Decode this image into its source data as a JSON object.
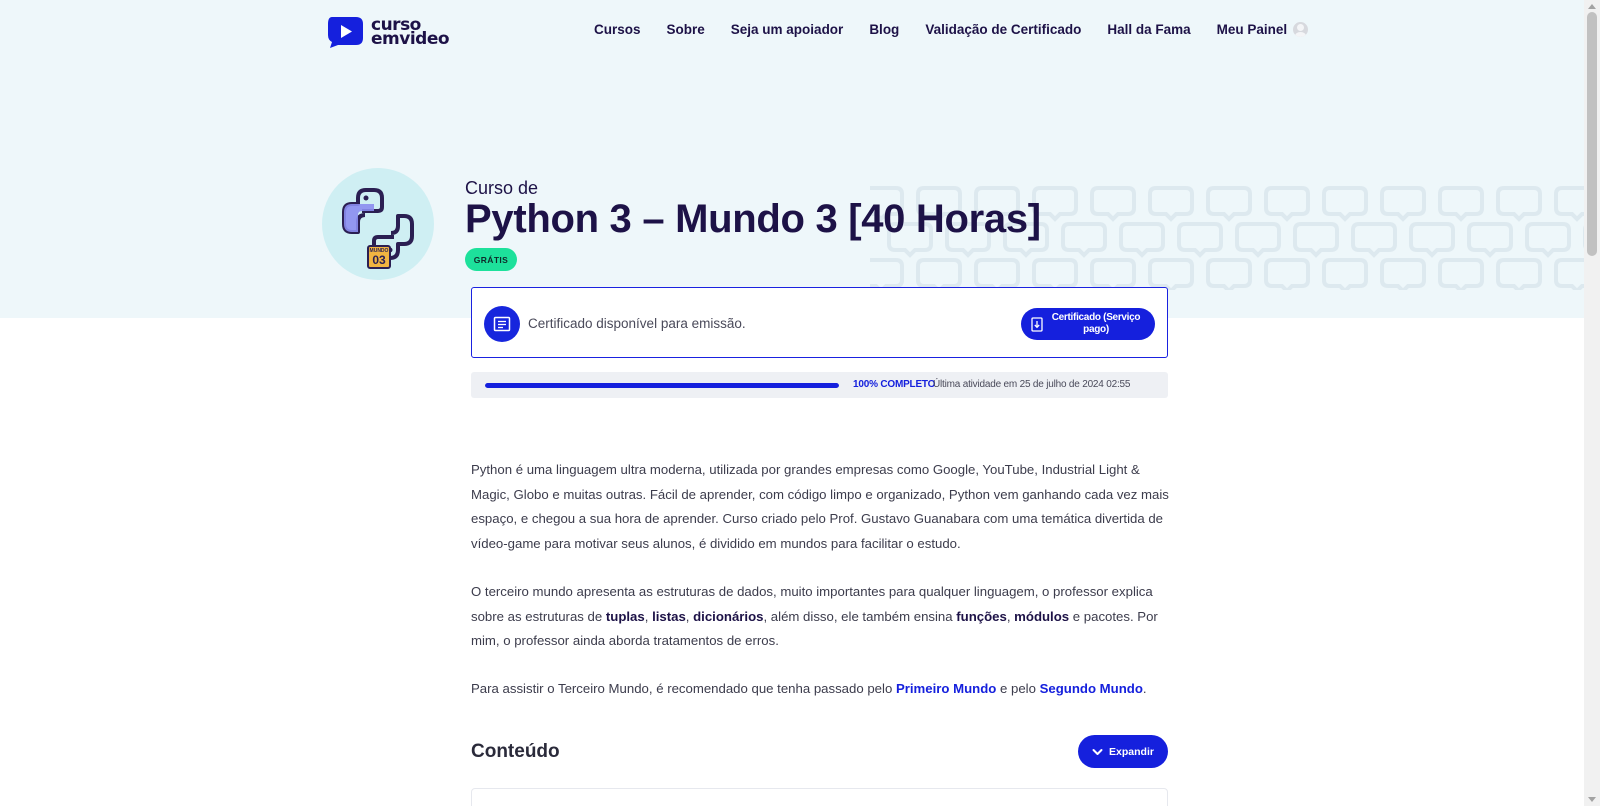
{
  "header": {
    "logo_line1": "curso",
    "logo_line2": "emvideo",
    "nav": [
      "Cursos",
      "Sobre",
      "Seja um apoiador",
      "Blog",
      "Validação de Certificado",
      "Hall da Fama"
    ],
    "account_label": "Meu Painel"
  },
  "course": {
    "pre_title": "Curso de",
    "title": "Python 3 – Mundo 3 [40 Horas]",
    "badge": "GRÁTIS",
    "icon_badge_small": "MUNDO",
    "icon_badge_big": "03"
  },
  "certificate": {
    "message": "Certificado disponível para emissão.",
    "button_label": "Certificado (Serviço pago)"
  },
  "progress": {
    "percent": 100,
    "label": "100% COMPLETO",
    "last_activity": "Última atividade em 25 de julho de 2024 02:55"
  },
  "description": {
    "p1": "Python é uma linguagem ultra moderna, utilizada por grandes empresas como Google, YouTube, Industrial Light & Magic, Globo e muitas outras. Fácil de aprender, com código limpo e organizado, Python vem ganhando cada vez mais espaço, e chegou a sua hora de aprender. Curso criado pelo Prof. Gustavo Guanabara com uma temática divertida de vídeo-game para motivar seus alunos, é dividido em mundos para facilitar o estudo.",
    "p2_a": "O terceiro mundo apresenta as estruturas de dados, muito importantes para qualquer linguagem, o professor explica sobre as estruturas de ",
    "p2_tuplas": "tuplas",
    "p2_sep1": ", ",
    "p2_listas": "listas",
    "p2_sep2": ", ",
    "p2_dicionarios": "dicionários",
    "p2_b": ", além disso, ele também ensina ",
    "p2_funcoes": "funções",
    "p2_sep3": ", ",
    "p2_modulos": "módulos",
    "p2_c": " e pacotes. Por mim, o professor ainda aborda tratamentos de erros.",
    "p3_a": "Para assistir o Terceiro Mundo, é recomendado que tenha passado pelo ",
    "p3_link1": "Primeiro Mundo",
    "p3_b": " e pelo ",
    "p3_link2": "Segundo Mundo",
    "p3_c": "."
  },
  "content_section": {
    "heading": "Conteúdo",
    "expand_label": "Expandir"
  },
  "colors": {
    "primary": "#1520dd",
    "navy": "#1d1247",
    "hero_bg": "#eef7fa",
    "badge_green": "#1de19b"
  }
}
